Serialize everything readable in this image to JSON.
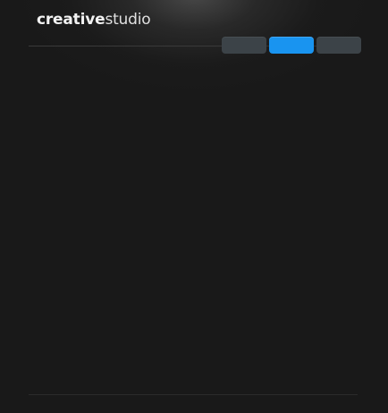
{
  "brand": {
    "bold": "creative",
    "light": "studio"
  },
  "nav": {
    "items": [
      {
        "label": "",
        "state": "inactive"
      },
      {
        "label": "",
        "state": "active"
      },
      {
        "label": "",
        "state": "inactive"
      }
    ]
  },
  "colors": {
    "background": "#191919",
    "nav_inactive": "#3c4348",
    "nav_active": "#1994f0",
    "logo_text": "#e6e6e6"
  }
}
